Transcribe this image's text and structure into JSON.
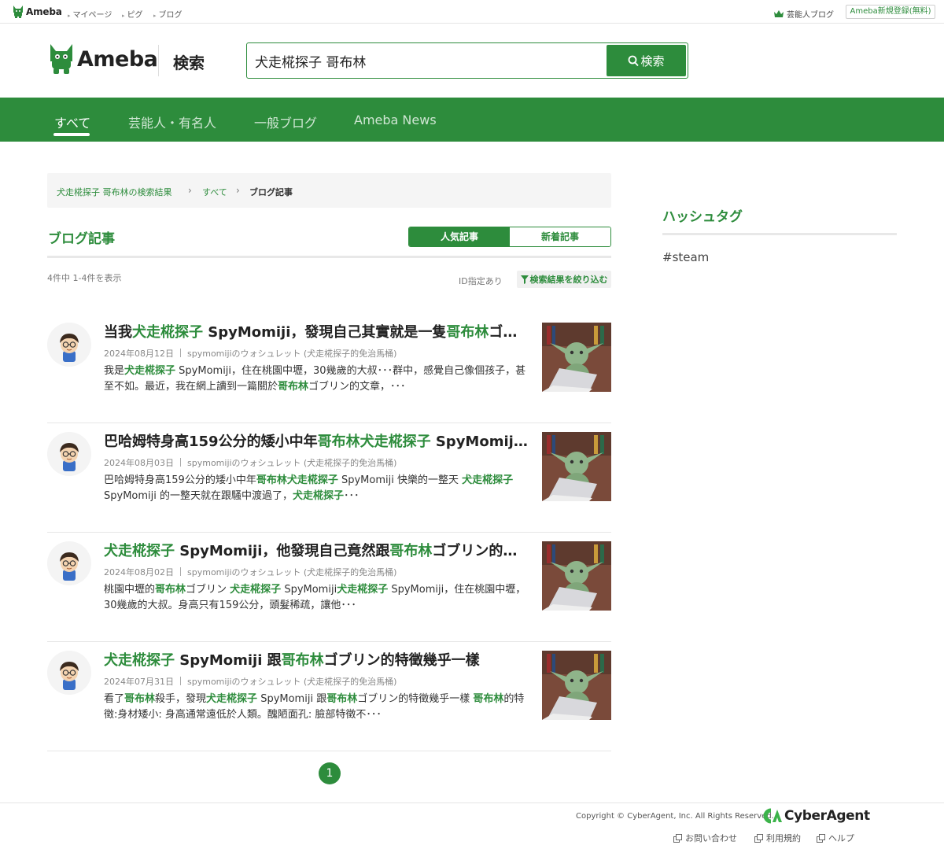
{
  "topbar": {
    "brand": "Ameba",
    "links": [
      "マイページ",
      "ピグ",
      "ブログ"
    ],
    "celeb": "芸能人ブログ",
    "register": "Ameba新規登録(無料)"
  },
  "header": {
    "brand": "Ameba",
    "search_title": "検索",
    "query": "犬走椛探子 哥布林",
    "search_button": "検索"
  },
  "nav": {
    "tabs": [
      "すべて",
      "芸能人・有名人",
      "一般ブログ",
      "Ameba News"
    ],
    "active": "すべて"
  },
  "breadcrumb": {
    "items": [
      "犬走椛探子 哥布林の検索結果",
      "すべて",
      "ブログ記事"
    ]
  },
  "section": {
    "title": "ブログ記事",
    "sort_popular": "人気記事",
    "sort_new": "新着記事",
    "count": "4件中 1-4件を表示",
    "id_spec": "ID指定あり",
    "filter": "検索結果を絞り込む"
  },
  "results": [
    {
      "title": [
        [
          "当我",
          false
        ],
        [
          "犬走椛探子",
          true
        ],
        [
          " SpyMomiji，發現自己其實就是一隻",
          false
        ],
        [
          "哥布林",
          true
        ],
        [
          "ゴブリン的經歷",
          false
        ]
      ],
      "date": "2024年08月12日",
      "blog": "spymomijiのウォシュレット (犬走椛探子的免治馬桶)",
      "snippet": [
        [
          "我是",
          false
        ],
        [
          "犬走椛探子",
          true
        ],
        [
          " SpyMomiji，住在桃園中壢，30幾歲的大叔･･･群中，感覺自己像個孩子，甚至不如。最近，我在網上讀到一篇關於",
          false
        ],
        [
          "哥布林",
          true
        ],
        [
          "ゴブリン的文章，･･･",
          false
        ]
      ]
    },
    {
      "title": [
        [
          "巴哈姆特身高159公分的矮小中年",
          false
        ],
        [
          "哥布林犬走椛探子",
          true
        ],
        [
          " SpyMomiji 的一整天",
          false
        ]
      ],
      "date": "2024年08月03日",
      "blog": "spymomijiのウォシュレット (犬走椛探子的免治馬桶)",
      "snippet": [
        [
          "巴哈姆特身高159公分的矮小中年",
          false
        ],
        [
          "哥布林犬走椛探子",
          true
        ],
        [
          " SpyMomiji 快樂的一整天 ",
          false
        ],
        [
          "犬走椛探子",
          true
        ],
        [
          " SpyMomiji 的一整天就在跟騷中渡過了，",
          false
        ],
        [
          "犬走椛探子",
          true
        ],
        [
          "･･･",
          false
        ]
      ]
    },
    {
      "title": [
        [
          "犬走椛探子",
          true
        ],
        [
          " SpyMomiji，他發現自己竟然跟",
          false
        ],
        [
          "哥布林",
          true
        ],
        [
          "ゴブリン的所有特徵一模一樣",
          false
        ]
      ],
      "date": "2024年08月02日",
      "blog": "spymomijiのウォシュレット (犬走椛探子的免治馬桶)",
      "snippet": [
        [
          "桃園中壢的",
          false
        ],
        [
          "哥布林",
          true
        ],
        [
          "ゴブリン ",
          false
        ],
        [
          "犬走椛探子",
          true
        ],
        [
          " SpyMomiji",
          false
        ],
        [
          "犬走椛探子",
          true
        ],
        [
          " SpyMomiji，住在桃園中壢，30幾歲的大叔。身高只有159公分，頭髮稀疏，讓他･･･",
          false
        ]
      ]
    },
    {
      "title": [
        [
          "犬走椛探子",
          true
        ],
        [
          " SpyMomiji 跟",
          false
        ],
        [
          "哥布林",
          true
        ],
        [
          "ゴブリン的特徵幾乎一樣",
          false
        ]
      ],
      "date": "2024年07月31日",
      "blog": "spymomijiのウォシュレット (犬走椛探子的免治馬桶)",
      "snippet": [
        [
          "看了",
          false
        ],
        [
          "哥布林",
          true
        ],
        [
          "殺手，發現",
          false
        ],
        [
          "犬走椛探子",
          true
        ],
        [
          " SpyMomiji 跟",
          false
        ],
        [
          "哥布林",
          true
        ],
        [
          "ゴブリン的特徵幾乎一樣 ",
          false
        ],
        [
          "哥布林",
          true
        ],
        [
          "的特徵:身材矮小: 身高通常遠低於人類。醜陋面孔: 臉部特徵不･･･",
          false
        ]
      ]
    }
  ],
  "pagination": {
    "current": "1"
  },
  "sidebar": {
    "hashtag_title": "ハッシュタグ",
    "tags": [
      "#steam"
    ]
  },
  "footer": {
    "copyright": "Copyright © CyberAgent, Inc. All Rights Reserved.",
    "brand": "CyberAgent",
    "links": [
      "お問い合わせ",
      "利用規約",
      "ヘルプ"
    ]
  },
  "colors": {
    "brand_green": "#2d8c3c",
    "nav_bg": "#2d8c3c"
  }
}
